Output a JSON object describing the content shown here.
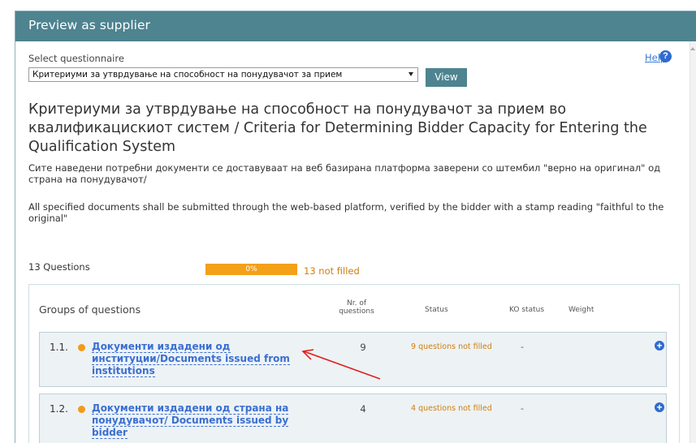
{
  "window": {
    "title": "Preview as supplier"
  },
  "help": {
    "label": "Help",
    "icon": "question-icon",
    "glyph": "?"
  },
  "selector": {
    "label": "Select questionnaire",
    "selected_value": "Критериуми за утврдување на способност на понудувачот за прием",
    "view_label": "View"
  },
  "questionnaire": {
    "heading": "Критериуми за утврдување на способност на понудувачот за прием во квалификацискиот систем / Criteria for Determining Bidder Capacity for Entering the Qualification System",
    "description_mk": "Сите наведени потребни документи се доставуваат на веб базирана платформа заверени со штембил \"верно на оригинал\" од страна на понудувачот/",
    "description_en": "All specified documents shall be submitted through the web-based platform, verified by the bidder with a stamp reading \"faithful to the original\""
  },
  "summary": {
    "questions_count": "13 Questions",
    "progress_label": "0%",
    "progress_value": 0,
    "not_filled": "13 not filled"
  },
  "groups_table": {
    "title": "Groups of questions",
    "col_nr": "Nr. of questions",
    "col_status": "Status",
    "col_ko": "KO status",
    "col_weight": "Weight",
    "rows": [
      {
        "number": "1.1.",
        "name": "Документи издадени од институции/Documents issued from institutions",
        "count": "9",
        "status": "9 questions not filled",
        "ko": "-"
      },
      {
        "number": "1.2.",
        "name": "Документи издадени од страна на понудувачот/ Documents issued by bidder",
        "count": "4",
        "status": "4 questions not filled",
        "ko": "-"
      }
    ]
  },
  "colors": {
    "header_teal": "#4e8390",
    "progress_orange": "#f4a019",
    "status_orange": "#cf7f0e",
    "link_blue": "#3a6fd0",
    "annotation_red": "#e02020"
  }
}
